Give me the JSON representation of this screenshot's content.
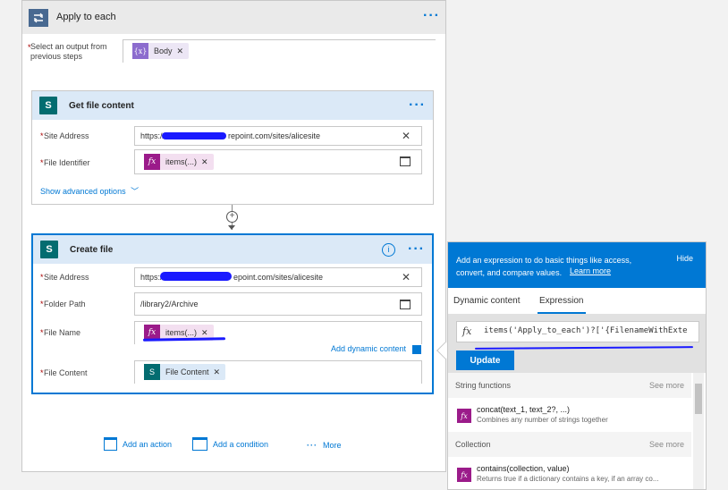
{
  "apply_each": {
    "title": "Apply to each",
    "select_label": "Select an output from previous steps",
    "token_label": "Body"
  },
  "get_file": {
    "title": "Get file content",
    "site_label": "Site Address",
    "site_value": "https://",
    "site_value_suffix": "repoint.com/sites/alicesite",
    "file_id_label": "File Identifier",
    "token_label": "items(...)",
    "show_advanced": "Show advanced options"
  },
  "create_file": {
    "title": "Create file",
    "site_label": "Site Address",
    "site_value": "https://",
    "site_value_suffix": "epoint.com/sites/alicesite",
    "folder_label": "Folder Path",
    "folder_value": "/library2/Archive",
    "name_label": "File Name",
    "name_token": "items(...)",
    "content_label": "File Content",
    "content_token": "File Content",
    "add_dynamic": "Add dynamic content"
  },
  "actions": {
    "add_action": "Add an action",
    "add_condition": "Add a condition",
    "more": "More"
  },
  "panel": {
    "header_text": "Add an expression to do basic things like access, convert, and compare values.",
    "learn_more": "Learn more",
    "hide": "Hide",
    "tab_dynamic": "Dynamic content",
    "tab_expression": "Expression",
    "expression_value": "items('Apply_to_each')?['{FilenameWithExte",
    "update": "Update",
    "see_more": "See more",
    "sections": [
      {
        "title": "String functions",
        "fn_name": "concat(text_1, text_2?, ...)",
        "fn_desc": "Combines any number of strings together"
      },
      {
        "title": "Collection",
        "fn_name": "contains(collection, value)",
        "fn_desc": "Returns true if a dictionary contains a key, if an array co..."
      }
    ]
  },
  "colors": {
    "accent": "#0078d4",
    "fx": "#9b1b8a",
    "sharepoint": "#036c70"
  }
}
